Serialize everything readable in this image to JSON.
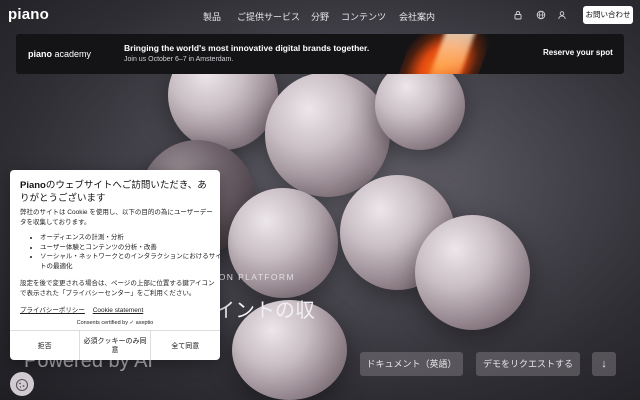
{
  "brand": {
    "logo": "piano"
  },
  "nav": {
    "items": [
      "製品",
      "ご提供サービス",
      "分野",
      "コンテンツ",
      "会社案内"
    ],
    "icons": [
      "lock-icon",
      "globe-icon",
      "user-icon"
    ],
    "contact_button": "お問い合わせ"
  },
  "banner": {
    "academy_brand": "piano",
    "academy_word": "academy",
    "title": "Bringing the world's most innovative digital brands together.",
    "subtitle": "Join us October 6–7 in Amsterdam.",
    "cta": "Reserve your spot",
    "close": "✕"
  },
  "hero": {
    "eyebrow": "ION PLATFORM",
    "headline": "イントの収",
    "powered": "Powered by AI",
    "btn_docs": "ドキュメント（英語）",
    "btn_demo": "デモをリクエストする",
    "btn_scroll": "↓"
  },
  "cookie": {
    "title_brand": "Piano",
    "title_rest": "のウェブサイトへご訪問いただき、ありがとうございます",
    "intro": "弊社のサイトは Cookie を使用し、以下の目的の為にユーザーデータを収集しております。",
    "purposes": [
      "オーディエンスの計測・分析",
      "ユーザー体験とコンテンツの分析・改善",
      "ソーシャル・ネットワークとのインタラクションにおけるサイトの最適化"
    ],
    "settings_note": "設定を後で変更される場合は、ページの上部に位置する鍵アイコンで表示された「プライバシーセンター」をご利用ください。",
    "privacy_link": "プライバシーポリシー",
    "cookie_link": "Cookie statement",
    "certified": "Consents certified by ✓ axeptio",
    "btn_reject": "拒否",
    "btn_essential": "必須クッキーのみ同意",
    "btn_accept": "全て同意"
  },
  "colors": {
    "accent_orange": "#e0490f",
    "banner_bg": "#141416"
  }
}
